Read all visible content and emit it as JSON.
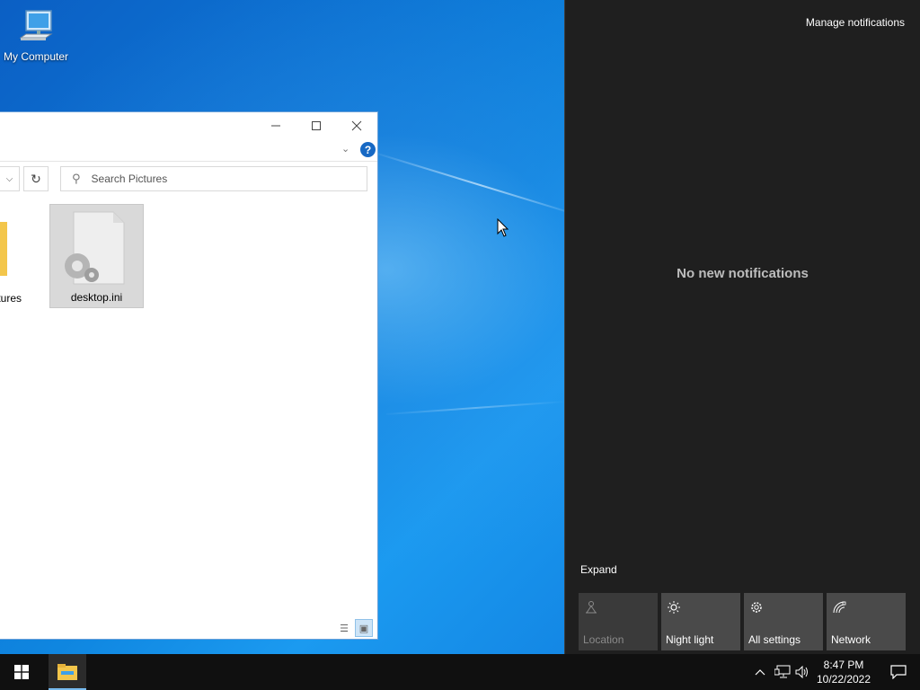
{
  "desktop": {
    "icon_label": "My Computer"
  },
  "explorer": {
    "search_placeholder": "Search Pictures",
    "help_label": "?",
    "files": [
      {
        "name": "tures"
      },
      {
        "name": "desktop.ini"
      }
    ]
  },
  "action_center": {
    "manage_label": "Manage notifications",
    "empty_label": "No new notifications",
    "expand_label": "Expand",
    "tiles": [
      {
        "label": "Location",
        "icon": "location-icon"
      },
      {
        "label": "Night light",
        "icon": "night-light-icon"
      },
      {
        "label": "All settings",
        "icon": "gear-icon"
      },
      {
        "label": "Network",
        "icon": "network-icon"
      }
    ]
  },
  "taskbar": {
    "time": "8:47 PM",
    "date": "10/22/2022"
  },
  "colors": {
    "action_center_bg": "#1f1f1f",
    "tile_bg": "#4a4a4a",
    "taskbar_bg": "#101010",
    "accent": "#76b9ed"
  }
}
